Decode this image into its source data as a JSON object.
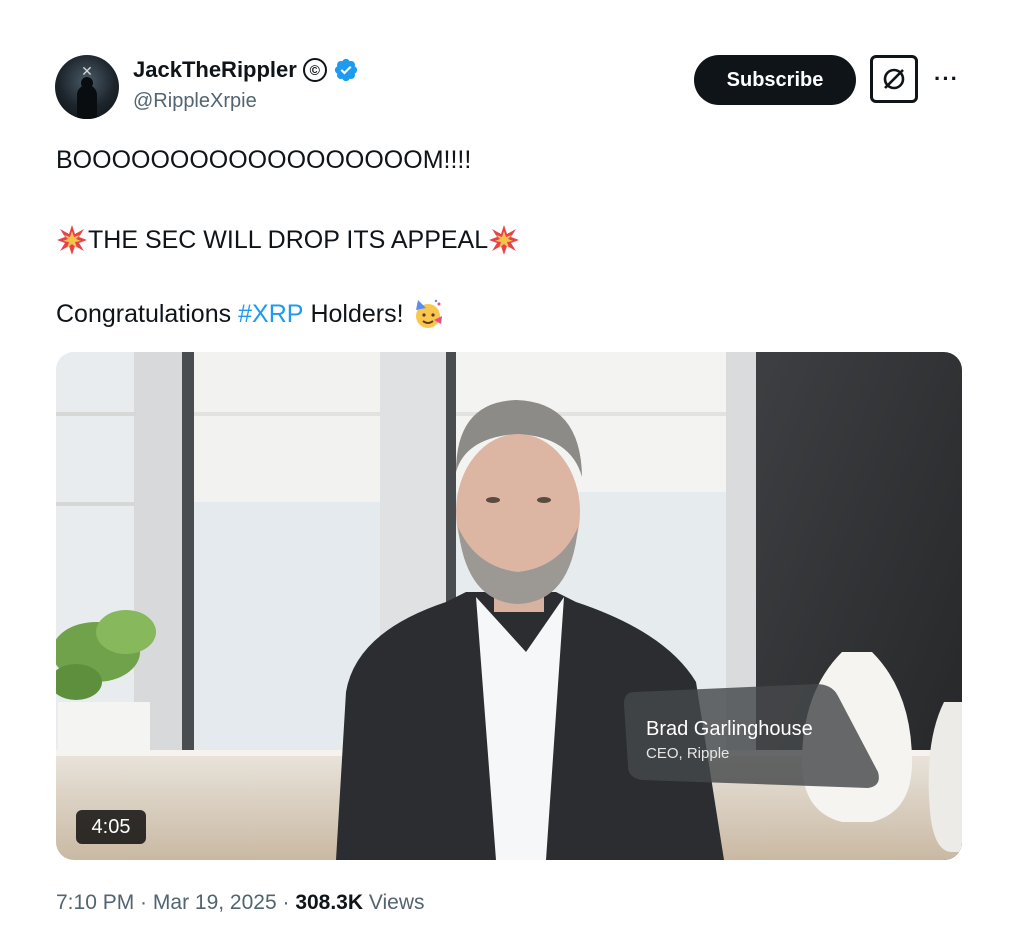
{
  "tweet": {
    "author": {
      "display_name": "JackTheRippler",
      "handle": "@RippleXrpie",
      "avatar_icon": "avatar-icon",
      "copyright_symbol": "©",
      "verified_color": "#1d9bf0"
    },
    "actions": {
      "subscribe_label": "Subscribe",
      "grok_icon": "slash-circle-icon",
      "more_label": "···"
    },
    "text": {
      "line1": "BOOOOOOOOOOOOOOOOOOM!!!!",
      "line2": "THE SEC WILL DROP ITS APPEAL",
      "line3_prefix": "Congratulations",
      "hashtag": "#XRP",
      "line3_suffix": "Holders!",
      "hashtag_color": "#1d9bf0"
    },
    "video": {
      "duration": "4:05",
      "lower_third_name": "Brad Garlinghouse",
      "lower_third_title": "CEO, Ripple"
    },
    "meta": {
      "time": "7:10 PM",
      "separator": " · ",
      "date": "Mar 19, 2025",
      "views_count": "308.3K",
      "views_label": "Views"
    }
  }
}
